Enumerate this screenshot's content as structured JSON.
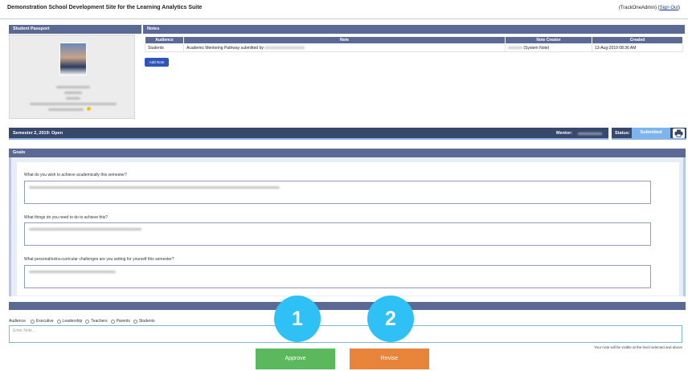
{
  "header": {
    "app_title": "Demonstration School Development Site for the Learning Analytics Suite",
    "user_prefix": "(TrackOneAdmin)",
    "sign_out": "Sign Out"
  },
  "passport": {
    "heading": "Student Passport"
  },
  "notes": {
    "heading": "Notes",
    "columns": [
      "Audience",
      "Note",
      "Note Creator",
      "Created"
    ],
    "rows": [
      {
        "audience": "Students",
        "note": "Academic Mentoring Pathway submitted by",
        "creator": "(System Note)",
        "created": "13-Aug-2019 08:36 AM"
      }
    ],
    "add_note_label": "Add Note"
  },
  "semester": {
    "label": "Semester 2, 2019:  Open",
    "mentor_label": "Mentor:",
    "status_label": "Status:",
    "status_value": "Submitted"
  },
  "goals": {
    "heading": "Goals",
    "questions": [
      "What do you wish to achieve academically this semester?",
      "What things do you need to do to achieve this?",
      "What personal/extra-curricular challenges are you setting for yourself this semester?"
    ]
  },
  "audience": {
    "label": "Audience",
    "options": [
      "Executive",
      "Leadership",
      "Teachers",
      "Parents",
      "Students"
    ]
  },
  "note_input": {
    "placeholder": "Enter Note..."
  },
  "visibility_note": "Your note will be visible at the level selected and above",
  "actions": {
    "approve": "Approve",
    "revise": "Revise"
  },
  "callouts": {
    "first": "1",
    "second": "2"
  },
  "colors": {
    "approve": "#5cb85c",
    "revise": "#e8833a",
    "callout": "#2fc1f5",
    "panel": "#5a6a94"
  }
}
